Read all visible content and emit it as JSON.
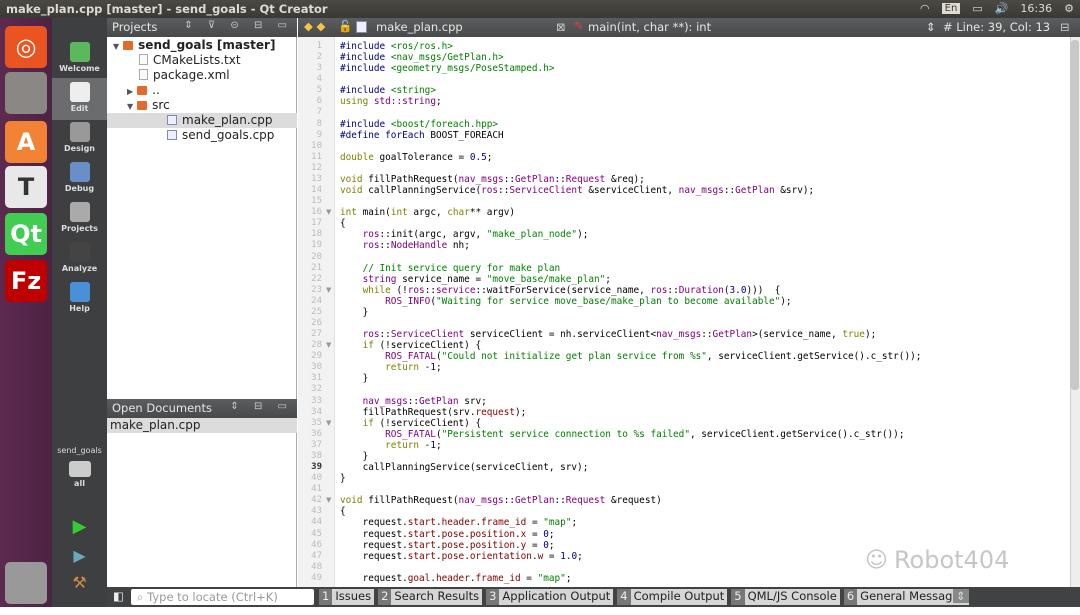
{
  "window": {
    "title": "make_plan.cpp [master] - send_goals - Qt Creator"
  },
  "tray": {
    "keyboard": "En",
    "clock": "16:36"
  },
  "launcher": {
    "items": [
      {
        "name": "ubuntu",
        "color": "#e95420"
      },
      {
        "name": "files",
        "color": "#8a8784"
      },
      {
        "name": "software-center",
        "label": "A",
        "color": "#f28234"
      },
      {
        "name": "text-editor",
        "label": "T",
        "color": "#e8e8e8"
      },
      {
        "name": "qt-creator",
        "label": "Qt",
        "color": "#41cd52"
      },
      {
        "name": "filezilla",
        "label": "Fz",
        "color": "#bf0000"
      },
      {
        "name": "trash",
        "color": "#999"
      }
    ]
  },
  "modes": [
    {
      "label": "Welcome"
    },
    {
      "label": "Edit"
    },
    {
      "label": "Design"
    },
    {
      "label": "Debug"
    },
    {
      "label": "Projects"
    },
    {
      "label": "Analyze"
    },
    {
      "label": "Help"
    }
  ],
  "kit": {
    "project": "send_goals",
    "config": "all"
  },
  "projects": {
    "header": "Projects",
    "tree": [
      {
        "label": "send_goals [master]",
        "type": "folder",
        "depth": 0,
        "arrow": "▼",
        "bold": true
      },
      {
        "label": "CMakeLists.txt",
        "type": "file",
        "depth": 1
      },
      {
        "label": "package.xml",
        "type": "file",
        "depth": 1
      },
      {
        "label": "..",
        "type": "folder",
        "depth": 1,
        "arrow": "▶"
      },
      {
        "label": "src",
        "type": "folder",
        "depth": 1,
        "arrow": "▼"
      },
      {
        "label": "make_plan.cpp",
        "type": "cpp",
        "depth": 2,
        "selected": true
      },
      {
        "label": "send_goals.cpp",
        "type": "cpp",
        "depth": 2
      }
    ]
  },
  "open_documents": {
    "header": "Open Documents",
    "items": [
      "make_plan.cpp"
    ]
  },
  "editor_toolbar": {
    "file": "make_plan.cpp",
    "symbol": "main(int, char **): int",
    "position": "Line: 39, Col: 13"
  },
  "editor": {
    "current_line": 39,
    "fold_lines": [
      16,
      23,
      28,
      35,
      42
    ],
    "lines": [
      [
        [
          "p",
          "#include "
        ],
        [
          "s",
          "<ros/ros.h>"
        ]
      ],
      [
        [
          "p",
          "#include "
        ],
        [
          "s",
          "<nav_msgs/GetPlan.h>"
        ]
      ],
      [
        [
          "p",
          "#include "
        ],
        [
          "s",
          "<geometry_msgs/PoseStamped.h>"
        ]
      ],
      [],
      [
        [
          "p",
          "#include "
        ],
        [
          "s",
          "<string>"
        ]
      ],
      [
        [
          "k",
          "using "
        ],
        [
          "t",
          "std::string"
        ],
        [
          "",
          ";"
        ]
      ],
      [],
      [
        [
          "p",
          "#include "
        ],
        [
          "s",
          "<boost/foreach.hpp>"
        ]
      ],
      [
        [
          "p",
          "#define "
        ],
        [
          "n",
          "forEach"
        ],
        [
          "",
          " BOOST_FOREACH"
        ]
      ],
      [],
      [
        [
          "k",
          "double"
        ],
        [
          "",
          " goalTolerance = "
        ],
        [
          "n",
          "0.5"
        ],
        [
          "",
          ";"
        ]
      ],
      [],
      [
        [
          "k",
          "void"
        ],
        [
          "",
          " fillPathRequest("
        ],
        [
          "t",
          "nav_msgs"
        ],
        [
          "",
          "::"
        ],
        [
          "t",
          "GetPlan"
        ],
        [
          "",
          "::"
        ],
        [
          "t",
          "Request"
        ],
        [
          "",
          " &req);"
        ]
      ],
      [
        [
          "k",
          "void"
        ],
        [
          "",
          " callPlanningService("
        ],
        [
          "t",
          "ros"
        ],
        [
          "",
          "::"
        ],
        [
          "t",
          "ServiceClient"
        ],
        [
          "",
          " &serviceClient, "
        ],
        [
          "t",
          "nav_msgs"
        ],
        [
          "",
          "::"
        ],
        [
          "t",
          "GetPlan"
        ],
        [
          "",
          " &srv);"
        ]
      ],
      [],
      [
        [
          "k",
          "int"
        ],
        [
          "",
          " main("
        ],
        [
          "k",
          "int"
        ],
        [
          "",
          " argc, "
        ],
        [
          "k",
          "char"
        ],
        [
          "",
          "** argv)"
        ]
      ],
      [
        [
          "",
          "{"
        ]
      ],
      [
        [
          "",
          "    "
        ],
        [
          "t",
          "ros"
        ],
        [
          "",
          "::init(argc, argv, "
        ],
        [
          "s",
          "\"make_plan_node\""
        ],
        [
          "",
          ");"
        ]
      ],
      [
        [
          "",
          "    "
        ],
        [
          "t",
          "ros"
        ],
        [
          "",
          "::"
        ],
        [
          "t",
          "NodeHandle"
        ],
        [
          "",
          " nh;"
        ]
      ],
      [],
      [
        [
          "",
          "    "
        ],
        [
          "c",
          "// Init service query for make plan"
        ]
      ],
      [
        [
          "",
          "    "
        ],
        [
          "t",
          "string"
        ],
        [
          "",
          " service_name = "
        ],
        [
          "s",
          "\"move_base/make_plan\""
        ],
        [
          "",
          ";"
        ]
      ],
      [
        [
          "",
          "    "
        ],
        [
          "k",
          "while"
        ],
        [
          "",
          " (!"
        ],
        [
          "t",
          "ros"
        ],
        [
          "",
          "::"
        ],
        [
          "t",
          "service"
        ],
        [
          "",
          "::waitForService(service_name, "
        ],
        [
          "t",
          "ros"
        ],
        [
          "",
          "::"
        ],
        [
          "t",
          "Duration"
        ],
        [
          "",
          "("
        ],
        [
          "n",
          "3.0"
        ],
        [
          "",
          ")))  {"
        ]
      ],
      [
        [
          "",
          "        "
        ],
        [
          "t",
          "ROS_INFO"
        ],
        [
          "",
          "("
        ],
        [
          "s",
          "\"Waiting for service move_base/make_plan to become available\""
        ],
        [
          "",
          ");"
        ]
      ],
      [
        [
          "",
          "    }"
        ]
      ],
      [],
      [
        [
          "",
          "    "
        ],
        [
          "t",
          "ros"
        ],
        [
          "",
          "::"
        ],
        [
          "t",
          "ServiceClient"
        ],
        [
          "",
          " serviceClient = nh.serviceClient<"
        ],
        [
          "t",
          "nav_msgs"
        ],
        [
          "",
          "::"
        ],
        [
          "t",
          "GetPlan"
        ],
        [
          "",
          ">(service_name, "
        ],
        [
          "k",
          "true"
        ],
        [
          "",
          ");"
        ]
      ],
      [
        [
          "",
          "    "
        ],
        [
          "k",
          "if"
        ],
        [
          "",
          " (!serviceClient) {"
        ]
      ],
      [
        [
          "",
          "        "
        ],
        [
          "t",
          "ROS_FATAL"
        ],
        [
          "",
          "("
        ],
        [
          "s",
          "\"Could not initialize get plan service from %s\""
        ],
        [
          "",
          ", serviceClient.getService().c_str());"
        ]
      ],
      [
        [
          "",
          "        "
        ],
        [
          "k",
          "return"
        ],
        [
          "",
          " -"
        ],
        [
          "n",
          "1"
        ],
        [
          "",
          ";"
        ]
      ],
      [
        [
          "",
          "    }"
        ]
      ],
      [],
      [
        [
          "",
          "    "
        ],
        [
          "t",
          "nav_msgs"
        ],
        [
          "",
          "::"
        ],
        [
          "t",
          "GetPlan"
        ],
        [
          "",
          " srv;"
        ]
      ],
      [
        [
          "",
          "    fillPathRequest(srv."
        ],
        [
          "m",
          "request"
        ],
        [
          "",
          ");"
        ]
      ],
      [
        [
          "",
          "    "
        ],
        [
          "k",
          "if"
        ],
        [
          "",
          " (!serviceClient) {"
        ]
      ],
      [
        [
          "",
          "        "
        ],
        [
          "t",
          "ROS_FATAL"
        ],
        [
          "",
          "("
        ],
        [
          "s",
          "\"Persistent service connection to %s failed\""
        ],
        [
          "",
          ", serviceClient.getService().c_str());"
        ]
      ],
      [
        [
          "",
          "        "
        ],
        [
          "k",
          "return"
        ],
        [
          "",
          " -"
        ],
        [
          "n",
          "1"
        ],
        [
          "",
          ";"
        ]
      ],
      [
        [
          "",
          "    }"
        ]
      ],
      [
        [
          "",
          "    callPlanningService(serviceClient, srv);"
        ]
      ],
      [
        [
          "",
          "}"
        ]
      ],
      [],
      [
        [
          "k",
          "void"
        ],
        [
          "",
          " fillPathRequest("
        ],
        [
          "t",
          "nav_msgs"
        ],
        [
          "",
          "::"
        ],
        [
          "t",
          "GetPlan"
        ],
        [
          "",
          "::"
        ],
        [
          "t",
          "Request"
        ],
        [
          "",
          " &request)"
        ]
      ],
      [
        [
          "",
          "{"
        ]
      ],
      [
        [
          "",
          "    request."
        ],
        [
          "m",
          "start"
        ],
        [
          "",
          "."
        ],
        [
          "m",
          "header"
        ],
        [
          "",
          "."
        ],
        [
          "m",
          "frame_id"
        ],
        [
          "",
          " = "
        ],
        [
          "s",
          "\"map\""
        ],
        [
          "",
          ";"
        ]
      ],
      [
        [
          "",
          "    request."
        ],
        [
          "m",
          "start"
        ],
        [
          "",
          "."
        ],
        [
          "m",
          "pose"
        ],
        [
          "",
          "."
        ],
        [
          "m",
          "position"
        ],
        [
          "",
          "."
        ],
        [
          "m",
          "x"
        ],
        [
          "",
          " = "
        ],
        [
          "n",
          "0"
        ],
        [
          "",
          ";"
        ]
      ],
      [
        [
          "",
          "    request."
        ],
        [
          "m",
          "start"
        ],
        [
          "",
          "."
        ],
        [
          "m",
          "pose"
        ],
        [
          "",
          "."
        ],
        [
          "m",
          "position"
        ],
        [
          "",
          "."
        ],
        [
          "m",
          "y"
        ],
        [
          "",
          " = "
        ],
        [
          "n",
          "0"
        ],
        [
          "",
          ";"
        ]
      ],
      [
        [
          "",
          "    request."
        ],
        [
          "m",
          "start"
        ],
        [
          "",
          "."
        ],
        [
          "m",
          "pose"
        ],
        [
          "",
          "."
        ],
        [
          "m",
          "orientation"
        ],
        [
          "",
          "."
        ],
        [
          "m",
          "w"
        ],
        [
          "",
          " = "
        ],
        [
          "n",
          "1.0"
        ],
        [
          "",
          ";"
        ]
      ],
      [],
      [
        [
          "",
          "    request."
        ],
        [
          "m",
          "goal"
        ],
        [
          "",
          "."
        ],
        [
          "m",
          "header"
        ],
        [
          "",
          "."
        ],
        [
          "m",
          "frame_id"
        ],
        [
          "",
          " = "
        ],
        [
          "s",
          "\"map\""
        ],
        [
          "",
          ";"
        ]
      ]
    ]
  },
  "statusbar": {
    "locate_placeholder": "Type to locate (Ctrl+K)",
    "tabs": [
      {
        "n": "1",
        "label": "Issues"
      },
      {
        "n": "2",
        "label": "Search Results"
      },
      {
        "n": "3",
        "label": "Application Output"
      },
      {
        "n": "4",
        "label": "Compile Output"
      },
      {
        "n": "5",
        "label": "QML/JS Console"
      },
      {
        "n": "6",
        "label": "General Messages"
      }
    ]
  },
  "watermark": "Robot404"
}
